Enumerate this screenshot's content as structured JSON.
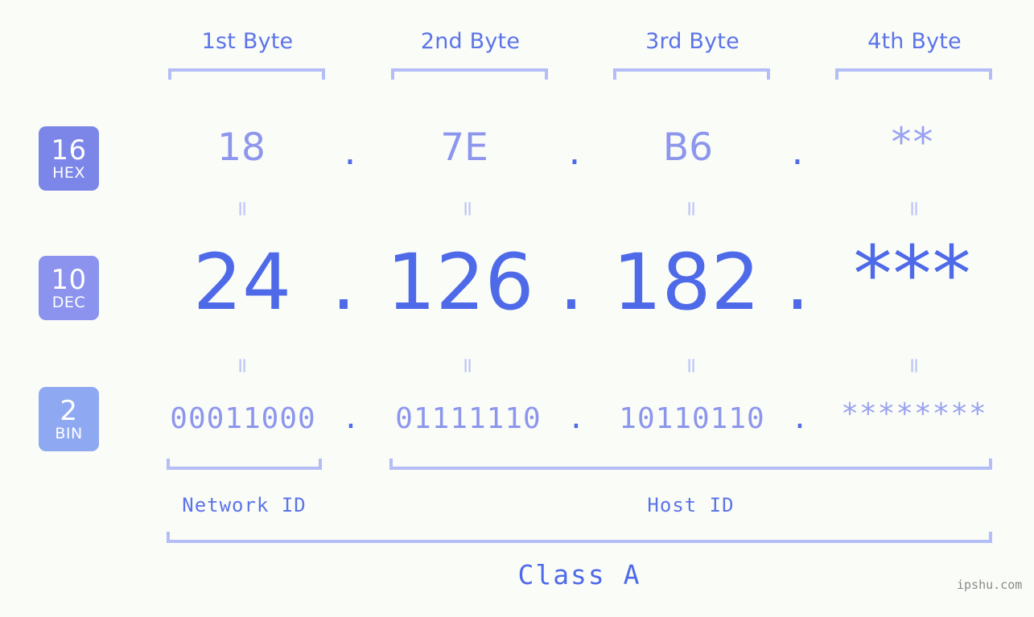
{
  "meta": {
    "background_color": "#fafcf8",
    "accent_strong": "#4f6ae8",
    "accent_mid": "#8d96ed",
    "accent_light": "#b4bdf6",
    "watermark": "ipshu.com"
  },
  "byte_headers": [
    {
      "label": "1st Byte"
    },
    {
      "label": "2nd Byte"
    },
    {
      "label": "3rd Byte"
    },
    {
      "label": "4th Byte"
    }
  ],
  "bases": [
    {
      "num": "16",
      "unit": "HEX",
      "color": "#7b86e8"
    },
    {
      "num": "10",
      "unit": "DEC",
      "color": "#8b93ee"
    },
    {
      "num": "2",
      "unit": "BIN",
      "color": "#8fa8f2"
    }
  ],
  "rows": {
    "hex": {
      "base_num": "16",
      "base_unit": "HEX",
      "values": [
        "18",
        "7E",
        "B6",
        "**"
      ],
      "separator": "."
    },
    "dec": {
      "base_num": "10",
      "base_unit": "DEC",
      "values": [
        "24",
        "126",
        "182",
        "***"
      ],
      "separator": "."
    },
    "bin": {
      "base_num": "2",
      "base_unit": "BIN",
      "values": [
        "00011000",
        "01111110",
        "10110110",
        "********"
      ],
      "separator": "."
    }
  },
  "equals_glyph": "=",
  "segments": {
    "network_id": "Network ID",
    "host_id": "Host ID",
    "class": "Class A"
  }
}
